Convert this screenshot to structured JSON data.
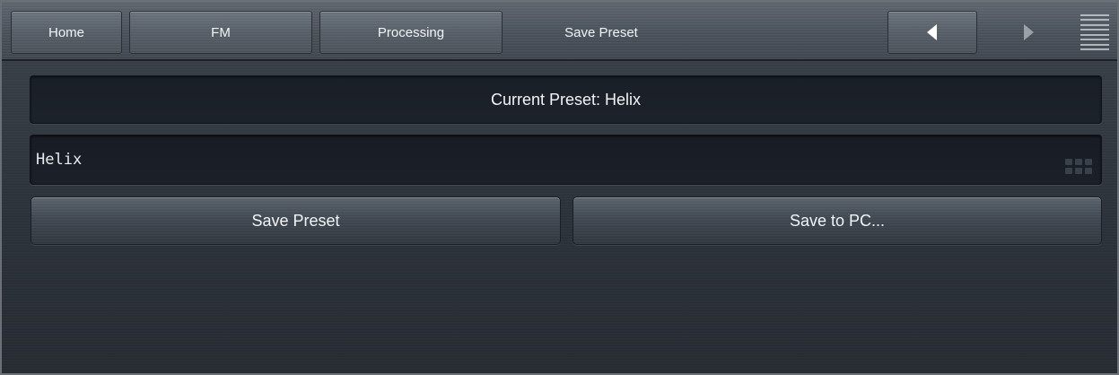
{
  "nav": {
    "home": "Home",
    "fm": "FM",
    "processing": "Processing",
    "current": "Save Preset"
  },
  "current_preset": {
    "label": "Current Preset: Helix"
  },
  "name_field": {
    "value": "Helix"
  },
  "actions": {
    "save_preset": "Save Preset",
    "save_to_pc": "Save to PC..."
  },
  "icons": {
    "back": "back-arrow-icon",
    "forward": "forward-arrow-icon",
    "menu": "menu-icon",
    "keypad": "keypad-icon"
  },
  "colors": {
    "background": "#2a2f36",
    "navbar": "#4a525b",
    "field": "#1a1f27",
    "text": "#f2f4f6"
  }
}
